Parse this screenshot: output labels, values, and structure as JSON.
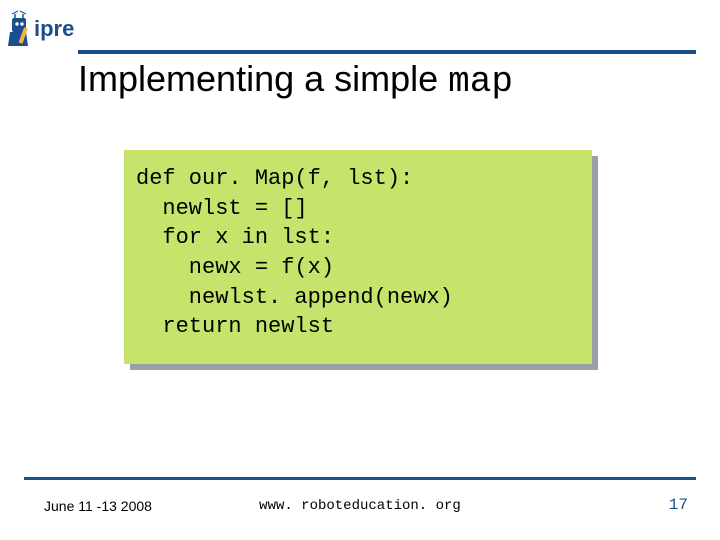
{
  "logo_text": "ipre",
  "title_plain": "Implementing a simple ",
  "title_code": "map",
  "code_lines": [
    "def our. Map(f, lst):",
    "  newlst = []",
    "  for x in lst:",
    "    newx = f(x)",
    "    newlst. append(newx)",
    "  return newlst"
  ],
  "footer": {
    "date": "June 11 -13 2008",
    "url": "www. roboteducation. org",
    "page": "17"
  },
  "colors": {
    "rule": "#1a4f8c",
    "code_bg": "#c6e36b"
  }
}
